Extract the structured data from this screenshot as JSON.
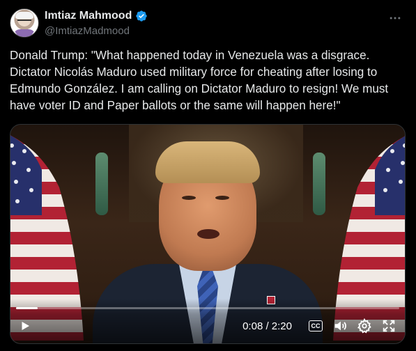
{
  "post": {
    "author_name": "Imtiaz Mahmood",
    "author_handle": "@ImtiazMadmood",
    "more_icon": "more-horizontal-icon",
    "text": "Donald Trump: \"What happened today in Venezuela was a disgrace. Dictator Nicolás Maduro used military force for cheating after losing to Edmundo González. I am calling on Dictator Maduro to resign! We must have voter ID and Paper ballots or the same will happen here!\""
  },
  "video": {
    "time_display": "0:08 / 2:20",
    "progress_fraction": 0.057,
    "cc_label": "CC",
    "icons": [
      "play-icon",
      "closed-captions-icon",
      "volume-icon",
      "settings-icon",
      "fullscreen-icon"
    ]
  },
  "colors": {
    "background": "#000000",
    "text": "#e7e9ea",
    "secondary_text": "#71767b",
    "verified": "#1d9bf0"
  }
}
